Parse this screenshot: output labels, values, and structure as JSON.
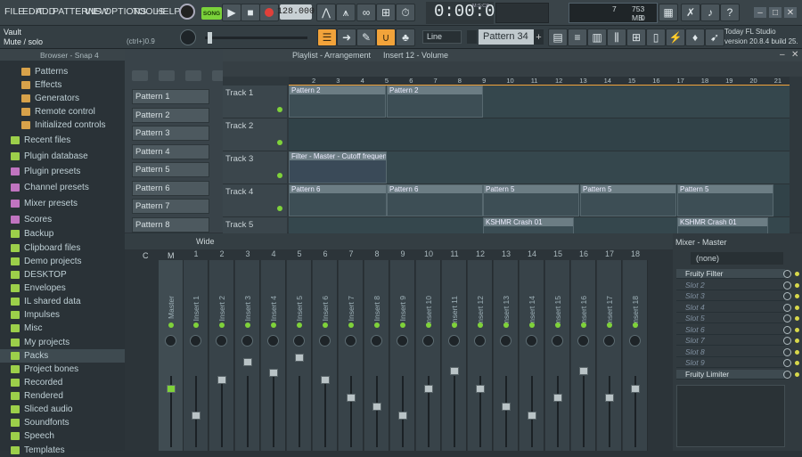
{
  "menu": [
    "FILE",
    "EDIT",
    "ADD",
    "PATTERNS",
    "VIEW",
    "OPTIONS",
    "TOOLS",
    "HELP"
  ],
  "transport": {
    "song_label": "SONG",
    "tempo": "128.000",
    "time": "0:00:00",
    "time_unit": "M:S:CS",
    "cpu_value": "7",
    "mem_value": "753 MB",
    "mem_sub": "0"
  },
  "hint": {
    "line1": "Vault",
    "line2": "Mute / solo",
    "shortcut": "(ctrl+)0.9"
  },
  "toolbar": {
    "snap_mode": "Line",
    "pattern": "Pattern 34"
  },
  "news": {
    "line1": "Today  FL Studio",
    "line2": "version 20.8.4 build 25."
  },
  "browser": {
    "title": "Browser - Snap 4",
    "items": [
      "Patterns",
      "Effects",
      "Generators",
      "Remote control",
      "Initialized controls",
      "Recent files",
      "Plugin database",
      "Plugin presets",
      "Channel presets",
      "Mixer presets",
      "Scores",
      "Backup",
      "Clipboard files",
      "Demo projects",
      "DESKTOP",
      "Envelopes",
      "IL shared data",
      "Impulses",
      "Misc",
      "My projects",
      "Packs",
      "Project bones",
      "Recorded",
      "Rendered",
      "Sliced audio",
      "Soundfonts",
      "Speech",
      "Templates"
    ]
  },
  "channel_rack": {
    "patterns": [
      "Pattern 1",
      "Pattern 2",
      "Pattern 3",
      "Pattern 4",
      "Pattern 5",
      "Pattern 6",
      "Pattern 7",
      "Pattern 8"
    ]
  },
  "playlist": {
    "title": "Playlist - Arrangement",
    "breadcrumb": "Insert 12 - Volume",
    "ruler": [
      "2",
      "3",
      "4",
      "5",
      "6",
      "7",
      "8",
      "9",
      "10",
      "11",
      "12",
      "13",
      "14",
      "15",
      "16",
      "17",
      "18",
      "19",
      "20",
      "21"
    ],
    "tracks": [
      "Track 1",
      "Track 2",
      "Track 3",
      "Track 4",
      "Track 5"
    ],
    "clips": {
      "p2a": "Pattern 2",
      "p2b": "Pattern 2",
      "auto": "Filter - Master - Cutoff frequency",
      "p6a": "Pattern 6",
      "p6b": "Pattern 6",
      "p5a": "Pattern 5",
      "p5b": "Pattern 5",
      "p5c": "Pattern 5",
      "crash1": "KSHMR Crash 01",
      "crash2": "KSHMR Crash 01"
    }
  },
  "mixer": {
    "view": "Wide",
    "title": "Mixer - Master",
    "header_c": "C",
    "header_m": "M",
    "master": "Master",
    "inserts": [
      "Insert 1",
      "Insert 2",
      "Insert 3",
      "Insert 4",
      "Insert 5",
      "Insert 6",
      "Insert 7",
      "Insert 8",
      "Insert 9",
      "Insert 10",
      "Insert 11",
      "Insert 12",
      "Insert 13",
      "Insert 14",
      "Insert 15",
      "Insert 16",
      "Insert 17",
      "Insert 18"
    ],
    "numbers": [
      "1",
      "2",
      "3",
      "4",
      "5",
      "6",
      "7",
      "8",
      "9",
      "10",
      "11",
      "12",
      "13",
      "14",
      "15",
      "16",
      "17",
      "18"
    ],
    "input": "(none)",
    "slots": [
      "Fruity Filter",
      "Slot 2",
      "Slot 3",
      "Slot 4",
      "Slot 5",
      "Slot 6",
      "Slot 7",
      "Slot 8",
      "Slot 9",
      "Fruity Limiter"
    ]
  }
}
